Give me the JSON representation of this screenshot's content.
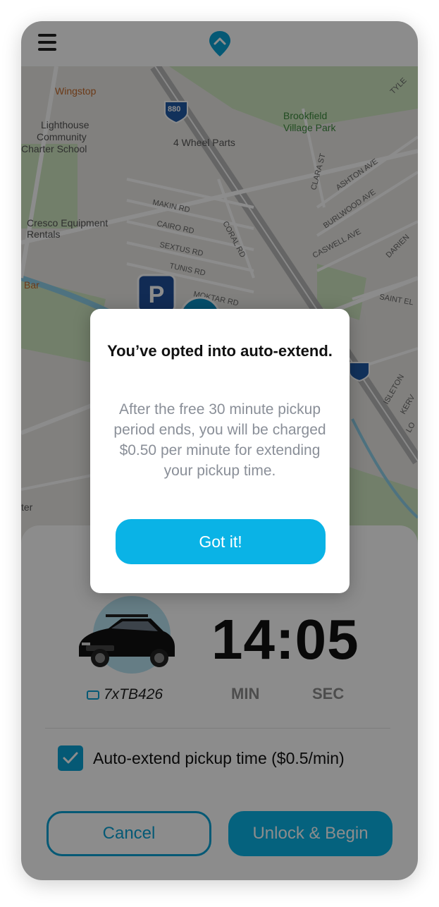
{
  "header": {
    "menu_icon": "hamburger-icon",
    "logo_icon": "location-pin-logo"
  },
  "map": {
    "labels": {
      "wingstop": "Wingstop",
      "lighthouse": "Lighthouse Community Charter School",
      "wheel_parts": "4 Wheel Parts",
      "brookfield": "Brookfield Village Park",
      "cresco": "Cresco Equipment Rentals",
      "bar": "Bar",
      "ter": "ter",
      "highway": "880",
      "streets": [
        "MAKIN RD",
        "CAIRO RD",
        "SEXTUS RD",
        "TUNIS RD",
        "MOKTAR RD",
        "CORAL RD",
        "CLARA ST",
        "ASHTON AVE",
        "BURLWOOD AVE",
        "CASWELL AVE",
        "DARIEN",
        "SAINT EL",
        "TYLE",
        "ISLETON",
        "KERV",
        "LO"
      ]
    },
    "parking_label": "P"
  },
  "modal": {
    "title": "You’ve opted into auto-extend.",
    "body": "After the free 30 minute pickup period ends, you will be charged $0.50 per minute for extending your pickup time.",
    "button": "Got it!"
  },
  "sheet": {
    "plate": "7xTB426",
    "timer": "14:05",
    "min_label": "MIN",
    "sec_label": "SEC",
    "auto_extend_label": "Auto-extend pickup time ($0.5/min)",
    "auto_extend_checked": true,
    "cancel_label": "Cancel",
    "unlock_label": "Unlock & Begin"
  },
  "colors": {
    "accent": "#0ab3e6",
    "accent_dark": "#0aa3d6",
    "park_green": "#cfe8c2",
    "water": "#8fd0ea"
  }
}
